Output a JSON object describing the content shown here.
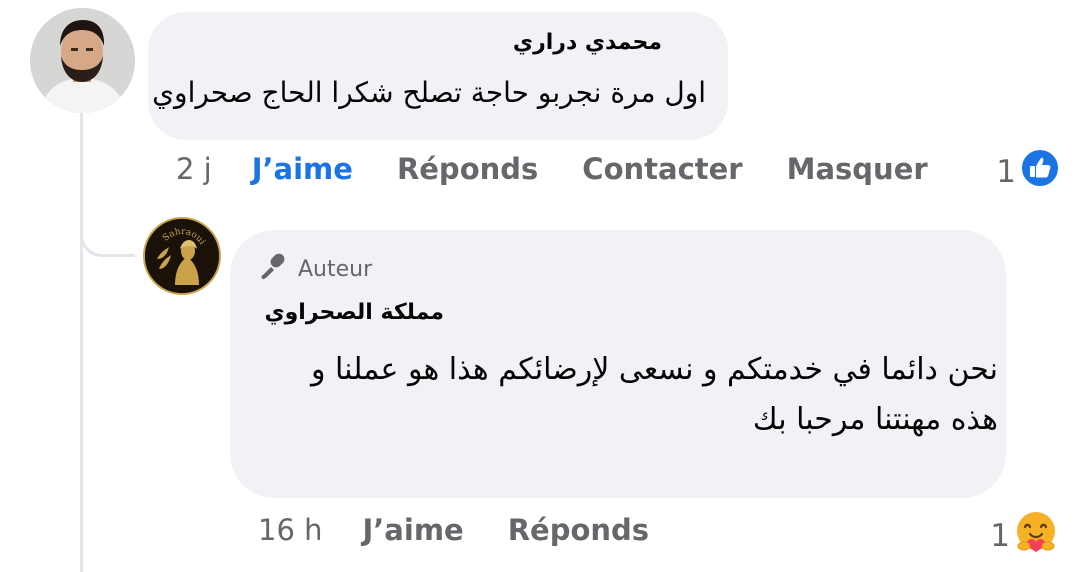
{
  "comment": {
    "author": "محمدي دراري",
    "text": "اول مرة نجربو حاجة تصلح شكرا الحاج صحراوي",
    "time": "2 j",
    "actions": {
      "like": "J’aime",
      "reply": "Réponds",
      "contact": "Contacter",
      "hide": "Masquer"
    },
    "reaction_count": "1",
    "reaction_icon": "like-icon"
  },
  "reply": {
    "badge": "Auteur",
    "author": "مملكة الصحراوي",
    "text": "نحن دائما في خدمتكم و نسعى لإرضائكم هذا هو عملنا و هذه مهنتنا مرحبا بك",
    "time": "16 h",
    "actions": {
      "like": "J’aime",
      "reply": "Réponds"
    },
    "reaction_count": "1",
    "reaction_icon": "care-icon",
    "avatar_logo_text": "Sahraoui"
  },
  "colors": {
    "accent": "#1b74e4",
    "bubble": "#f0f2f5",
    "meta": "#65676b",
    "logo_gold": "#c9a24a"
  }
}
